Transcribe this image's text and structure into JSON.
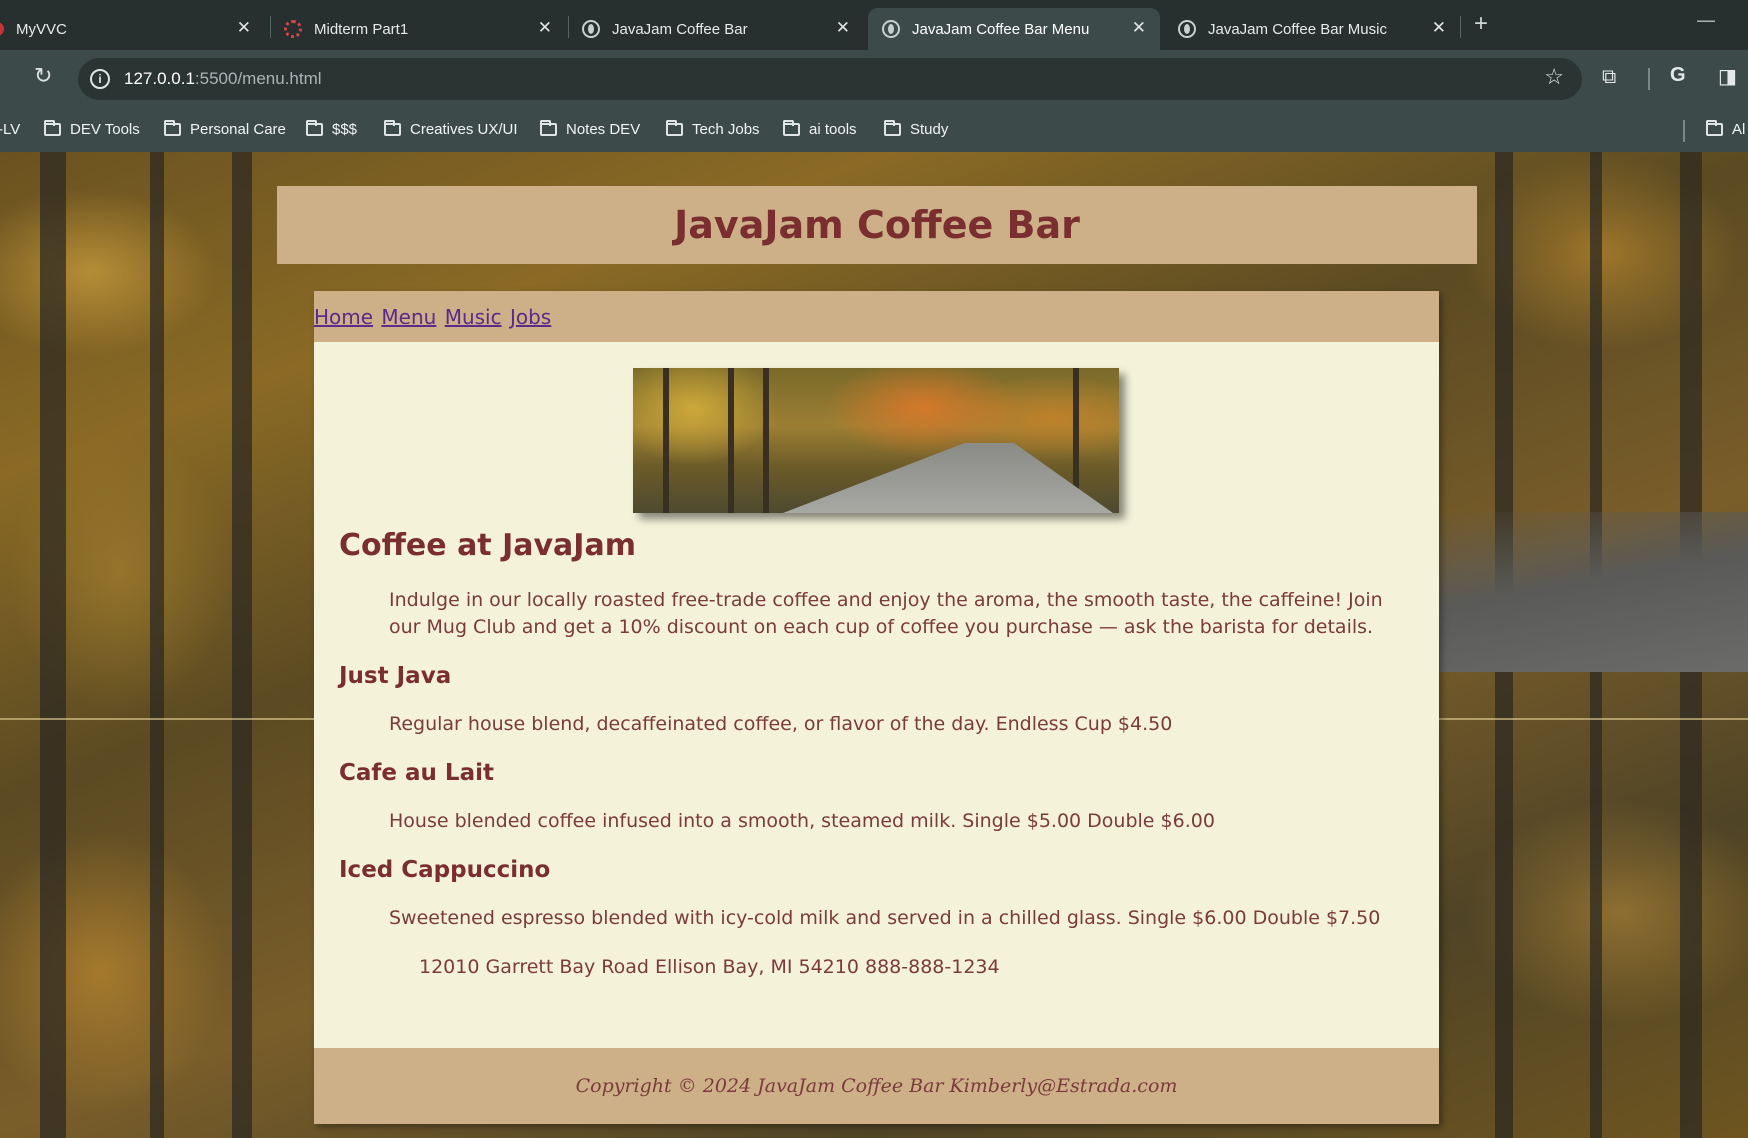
{
  "browser": {
    "tabs": [
      {
        "title": "MyVVC",
        "active": false
      },
      {
        "title": "Midterm Part1",
        "active": false
      },
      {
        "title": "JavaJam Coffee Bar",
        "active": false
      },
      {
        "title": "JavaJam Coffee Bar Menu",
        "active": true
      },
      {
        "title": "JavaJam Coffee Bar Music",
        "active": false
      }
    ],
    "tab_close": "✕",
    "new_tab": "+",
    "minimize": "—",
    "address": {
      "host": "127.0.0.1",
      "path": ":5500/menu.html"
    },
    "bookmarks": [
      "-LV",
      "DEV Tools",
      "Personal Care",
      "$$$",
      "Creatives UX/UI",
      "Notes DEV",
      "Tech Jobs",
      "ai tools",
      "Study",
      "Al"
    ]
  },
  "site": {
    "title": "JavaJam Coffee Bar",
    "nav": [
      "Home",
      "Menu",
      "Music",
      "Jobs"
    ],
    "heading": "Coffee at JavaJam",
    "intro": "Indulge in our locally roasted free-trade coffee and enjoy the aroma, the smooth taste, the caffeine! Join our Mug Club and get a 10% discount on each cup of coffee you purchase — ask the barista for details.",
    "items": [
      {
        "name": "Just Java",
        "description": "Regular house blend, decaffeinated coffee, or flavor of the day. Endless Cup $4.50"
      },
      {
        "name": "Cafe au Lait",
        "description": "House blended coffee infused into a smooth, steamed milk. Single $5.00 Double $6.00"
      },
      {
        "name": "Iced Cappuccino",
        "description": "Sweetened espresso blended with icy-cold milk and served in a chilled glass. Single $6.00 Double $7.50"
      }
    ],
    "address": "12010 Garrett Bay Road Ellison Bay, MI 54210 888-888-1234",
    "footer": "Copyright © 2024 JavaJam Coffee Bar Kimberly@Estrada.com"
  }
}
